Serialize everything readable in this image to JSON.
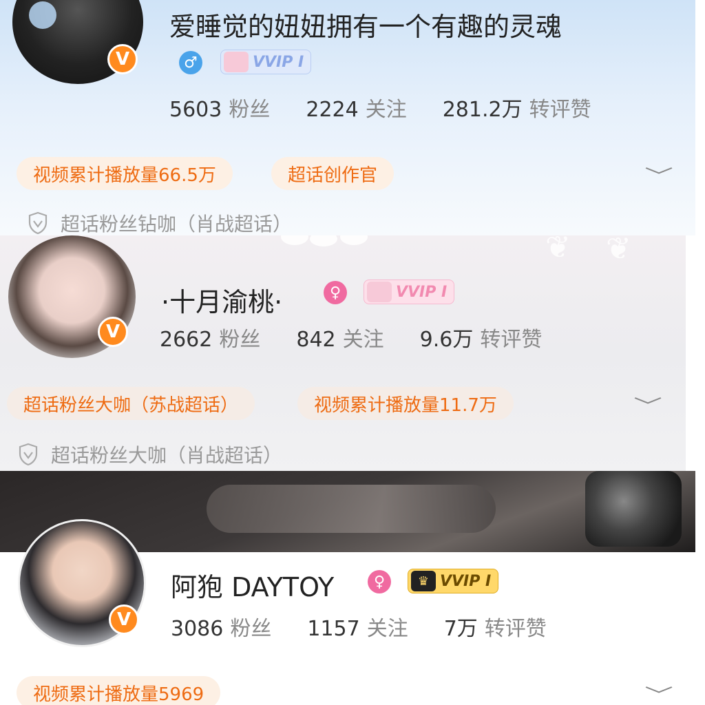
{
  "profiles": [
    {
      "name": "爱睡觉的妞妞拥有一个有趣的灵魂",
      "gender": "♂",
      "vip": "VVIP I",
      "stats": [
        {
          "num": "5603",
          "label": "粉丝"
        },
        {
          "num": "2224",
          "label": "关注"
        },
        {
          "num": "281.2万",
          "label": "转评赞"
        }
      ],
      "tags": [
        "视频累计播放量66.5万",
        "超话创作官"
      ],
      "badge": "超话粉丝钻咖（肖战超话）",
      "verified": "V"
    },
    {
      "name": "·十月渝桃·",
      "gender": "♀",
      "vip": "VVIP I",
      "stats": [
        {
          "num": "2662",
          "label": "粉丝"
        },
        {
          "num": "842",
          "label": "关注"
        },
        {
          "num": "9.6万",
          "label": "转评赞"
        }
      ],
      "tags": [
        "超话粉丝大咖（苏战超话）",
        "视频累计播放量11.7万"
      ],
      "badge": "超话粉丝大咖（肖战超话）",
      "verified": "V"
    },
    {
      "name": "阿狍 DAYTOY",
      "gender": "♀",
      "vip": "VVIP I",
      "stats": [
        {
          "num": "3086",
          "label": "粉丝"
        },
        {
          "num": "1157",
          "label": "关注"
        },
        {
          "num": "7万",
          "label": "转评赞"
        }
      ],
      "tags": [
        "视频累计播放量5969"
      ],
      "verified": "V"
    }
  ],
  "icons": {
    "expand": "chevron-down-icon",
    "shield": "shield-icon",
    "crown": "crown-icon"
  },
  "colors": {
    "accent": "#ee6b12",
    "verified": "#ff8a1e",
    "male": "#4aa3ea",
    "female": "#f06aa0"
  }
}
